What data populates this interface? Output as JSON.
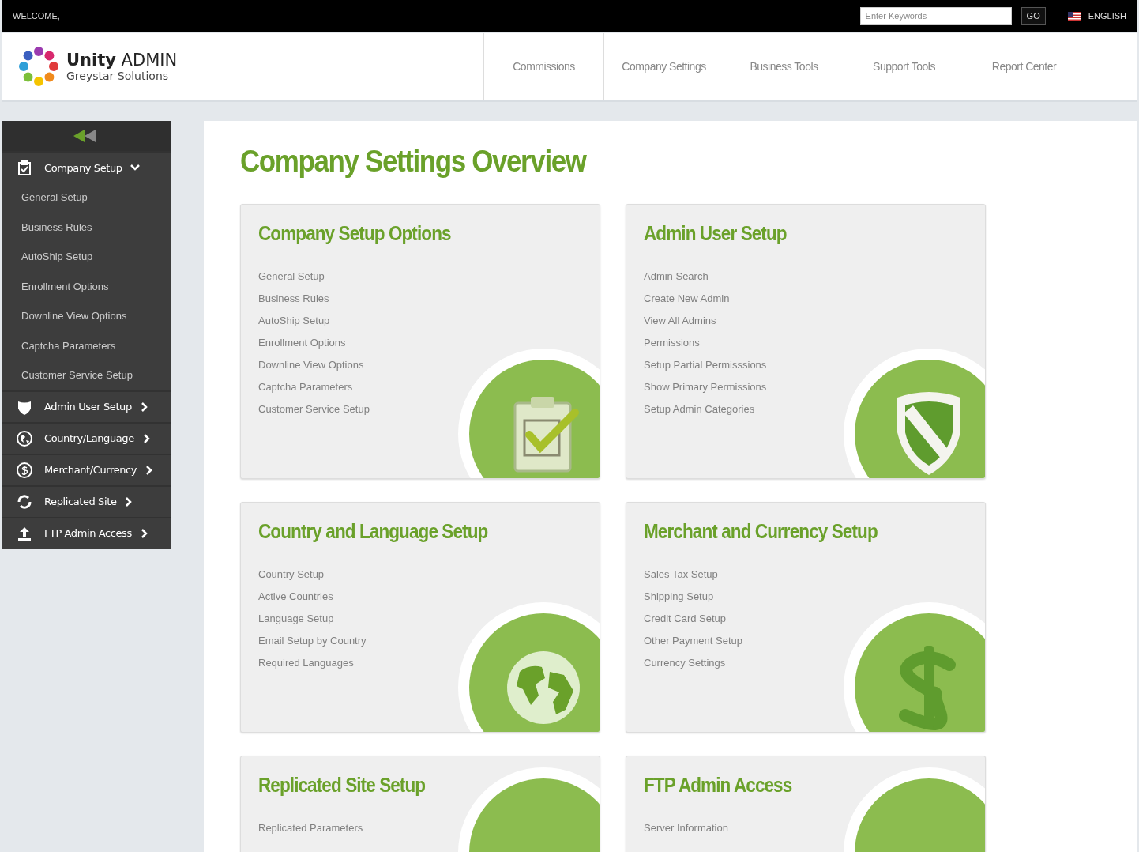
{
  "top_bar": {
    "welcome": "WELCOME,",
    "search": {
      "placeholder": "Enter Keywords"
    },
    "go_button": "GO",
    "language": "ENGLISH"
  },
  "header": {
    "logo_title": "**Unity** ADMIN",
    "logo_subtitle": "Greystar Solutions",
    "nav": [
      "Commissions",
      "Company Settings",
      "Business Tools",
      "Support Tools",
      "Report Center"
    ]
  },
  "sidebar": {
    "items": [
      {
        "label": "Company Setup",
        "expanded": true,
        "children": [
          "General Setup",
          "Business Rules",
          "AutoShip Setup",
          "Enrollment Options",
          "Downline View Options",
          "Captcha Parameters",
          "Customer Service Setup"
        ]
      },
      {
        "label": "Admin User Setup",
        "expanded": false
      },
      {
        "label": "Country/Language",
        "expanded": false
      },
      {
        "label": "Merchant/Currency",
        "expanded": false
      },
      {
        "label": "Replicated Site",
        "expanded": false
      },
      {
        "label": "FTP Admin Access",
        "expanded": false
      }
    ]
  },
  "main": {
    "title": "Company Settings Overview",
    "cards": [
      {
        "title": "Company Setup Options",
        "links": [
          "General Setup",
          "Business Rules",
          "AutoShip Setup",
          "Enrollment Options",
          "Downline View Options",
          "Captcha Parameters",
          "Customer Service Setup"
        ]
      },
      {
        "title": "Admin User Setup",
        "links": [
          "Admin Search",
          "Create New Admin",
          "View All Admins",
          "Permissions",
          "Setup Partial Permisssions",
          "Show Primary Permissions",
          "Setup Admin Categories"
        ]
      },
      {
        "title": "Country and Language Setup",
        "links": [
          "Country Setup",
          "Active Countries",
          "Language Setup",
          "Email Setup by Country",
          "Required Languages"
        ]
      },
      {
        "title": "Merchant and Currency Setup",
        "links": [
          "Sales Tax Setup",
          "Shipping Setup",
          "Credit Card Setup",
          "Other Payment Setup",
          "Currency Settings"
        ]
      },
      {
        "title": "Replicated Site Setup",
        "links": [
          "Replicated Parameters"
        ]
      },
      {
        "title": "FTP Admin Access",
        "links": [
          "Server Information"
        ]
      }
    ]
  }
}
